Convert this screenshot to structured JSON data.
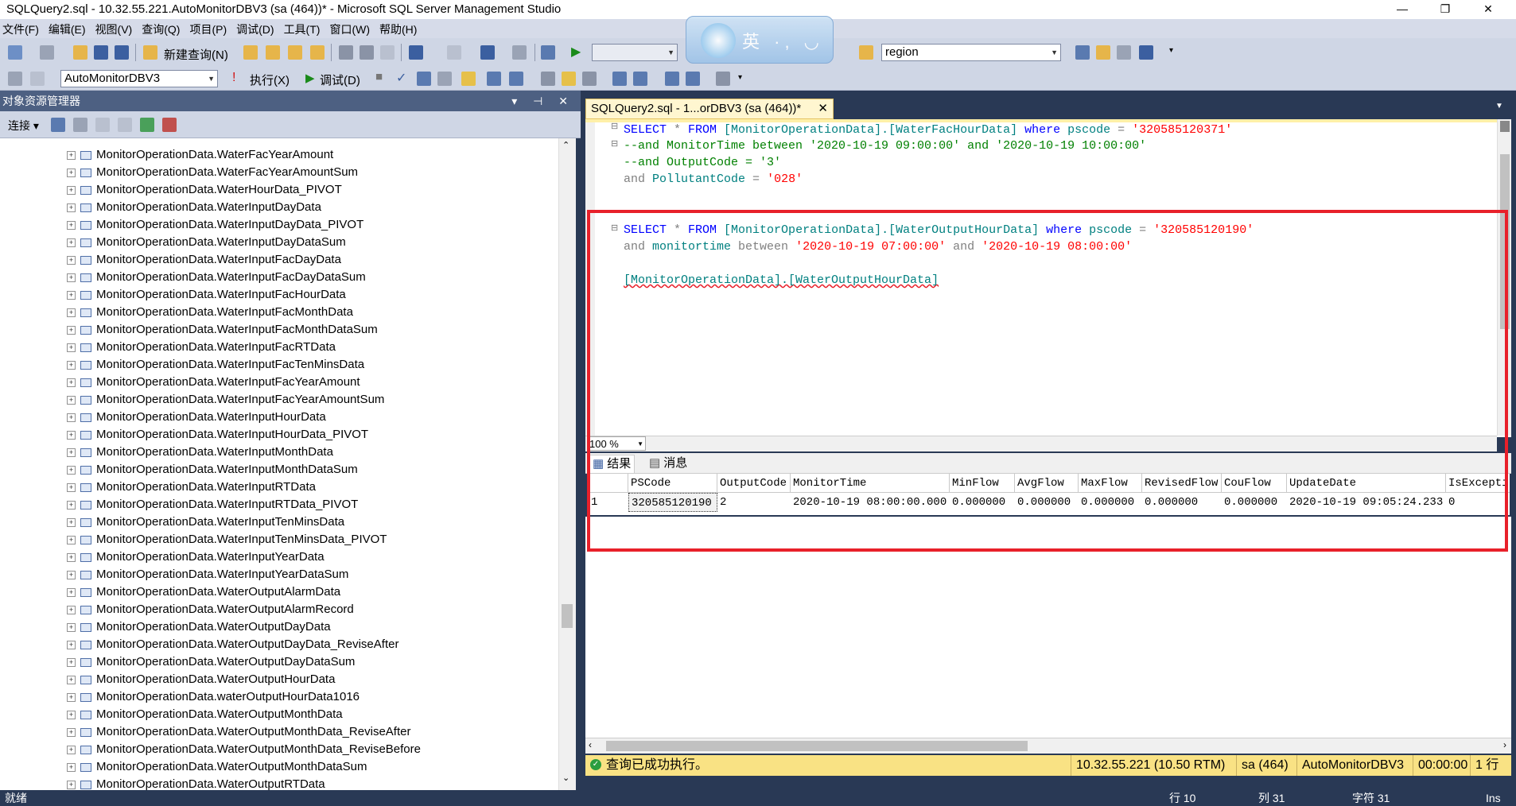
{
  "window": {
    "title": "SQLQuery2.sql - 10.32.55.221.AutoMonitorDBV3 (sa (464))* - Microsoft SQL Server Management Studio",
    "minimize": "—",
    "restore": "❐",
    "close": "✕"
  },
  "menu": [
    "文件(F)",
    "编辑(E)",
    "视图(V)",
    "查询(Q)",
    "项目(P)",
    "调试(D)",
    "工具(T)",
    "窗口(W)",
    "帮助(H)"
  ],
  "toolbar": {
    "new_query": "新建查询(N)",
    "region_combo": "region",
    "database_combo": "AutoMonitorDBV3",
    "execute": "执行(X)",
    "debug": "调试(D)"
  },
  "ime": {
    "label": "英 ·, ◡"
  },
  "object_explorer": {
    "title": "对象资源管理器",
    "header_icons": "▾ ⊣ ✕",
    "connect": "连接 ▾",
    "items": [
      "MonitorOperationData.WaterFacYearAmount",
      "MonitorOperationData.WaterFacYearAmountSum",
      "MonitorOperationData.WaterHourData_PIVOT",
      "MonitorOperationData.WaterInputDayData",
      "MonitorOperationData.WaterInputDayData_PIVOT",
      "MonitorOperationData.WaterInputDayDataSum",
      "MonitorOperationData.WaterInputFacDayData",
      "MonitorOperationData.WaterInputFacDayDataSum",
      "MonitorOperationData.WaterInputFacHourData",
      "MonitorOperationData.WaterInputFacMonthData",
      "MonitorOperationData.WaterInputFacMonthDataSum",
      "MonitorOperationData.WaterInputFacRTData",
      "MonitorOperationData.WaterInputFacTenMinsData",
      "MonitorOperationData.WaterInputFacYearAmount",
      "MonitorOperationData.WaterInputFacYearAmountSum",
      "MonitorOperationData.WaterInputHourData",
      "MonitorOperationData.WaterInputHourData_PIVOT",
      "MonitorOperationData.WaterInputMonthData",
      "MonitorOperationData.WaterInputMonthDataSum",
      "MonitorOperationData.WaterInputRTData",
      "MonitorOperationData.WaterInputRTData_PIVOT",
      "MonitorOperationData.WaterInputTenMinsData",
      "MonitorOperationData.WaterInputTenMinsData_PIVOT",
      "MonitorOperationData.WaterInputYearData",
      "MonitorOperationData.WaterInputYearDataSum",
      "MonitorOperationData.WaterOutputAlarmData",
      "MonitorOperationData.WaterOutputAlarmRecord",
      "MonitorOperationData.WaterOutputDayData",
      "MonitorOperationData.WaterOutputDayData_ReviseAfter",
      "MonitorOperationData.WaterOutputDayDataSum",
      "MonitorOperationData.WaterOutputHourData",
      "MonitorOperationData.waterOutputHourData1016",
      "MonitorOperationData.WaterOutputMonthData",
      "MonitorOperationData.WaterOutputMonthData_ReviseAfter",
      "MonitorOperationData.WaterOutputMonthData_ReviseBefore",
      "MonitorOperationData.WaterOutputMonthDataSum",
      "MonitorOperationData.WaterOutputRTData"
    ]
  },
  "editor": {
    "tab_label": "SQLQuery2.sql - 1...orDBV3 (sa (464))*",
    "tab_close": "✕",
    "zoom": "100 %",
    "code": {
      "l1": {
        "a": "SELECT",
        "b": " * ",
        "c": "FROM",
        "d": " [MonitorOperationData].[WaterFacHourData] ",
        "e": "where",
        "f": " pscode ",
        "g": "=",
        "h": " '320585120371'"
      },
      "l2": "--and MonitorTime between '2020-10-19 09:00:00' and '2020-10-19 10:00:00'",
      "l3": "--and OutputCode = '3'",
      "l4": {
        "a": "and",
        "b": " PollutantCode ",
        "c": "=",
        "d": " '028'"
      },
      "l5": {
        "a": "SELECT",
        "b": " * ",
        "c": "FROM",
        "d": " [MonitorOperationData].[WaterOutputHourData] ",
        "e": "where",
        "f": " pscode ",
        "g": "=",
        "h": " '320585120190'"
      },
      "l6": {
        "a": "and",
        "b": " monitortime ",
        "c": "between",
        "d": " '2020-10-19 07:00:00' ",
        "e": "and",
        "f": " '2020-10-19 08:00:00'"
      },
      "l7": "[MonitorOperationData].[WaterOutputHourData]"
    }
  },
  "results": {
    "tab_results": "结果",
    "tab_messages": "消息",
    "columns": [
      "PSCode",
      "OutputCode",
      "MonitorTime",
      "MinFlow",
      "AvgFlow",
      "MaxFlow",
      "RevisedFlow",
      "CouFlow",
      "UpdateDate",
      "IsExcepti"
    ],
    "row_number": "1",
    "row": [
      "320585120190",
      "2",
      "2020-10-19 08:00:00.000",
      "0.000000",
      "0.000000",
      "0.000000",
      "0.000000",
      "0.000000",
      "2020-10-19 09:05:24.233",
      "0"
    ]
  },
  "query_status": {
    "message": "查询已成功执行。",
    "server": "10.32.55.221 (10.50 RTM)",
    "user": "sa (464)",
    "database": "AutoMonitorDBV3",
    "elapsed": "00:00:00",
    "rows": "1 行"
  },
  "status_bar": {
    "ready": "就绪",
    "line": "行 10",
    "col": "列 31",
    "ch": "字符 31",
    "mode": "Ins"
  },
  "colors": {
    "accent_dark": "#293955",
    "highlight_box": "#e8202a",
    "query_status_bg": "#f9e284"
  }
}
